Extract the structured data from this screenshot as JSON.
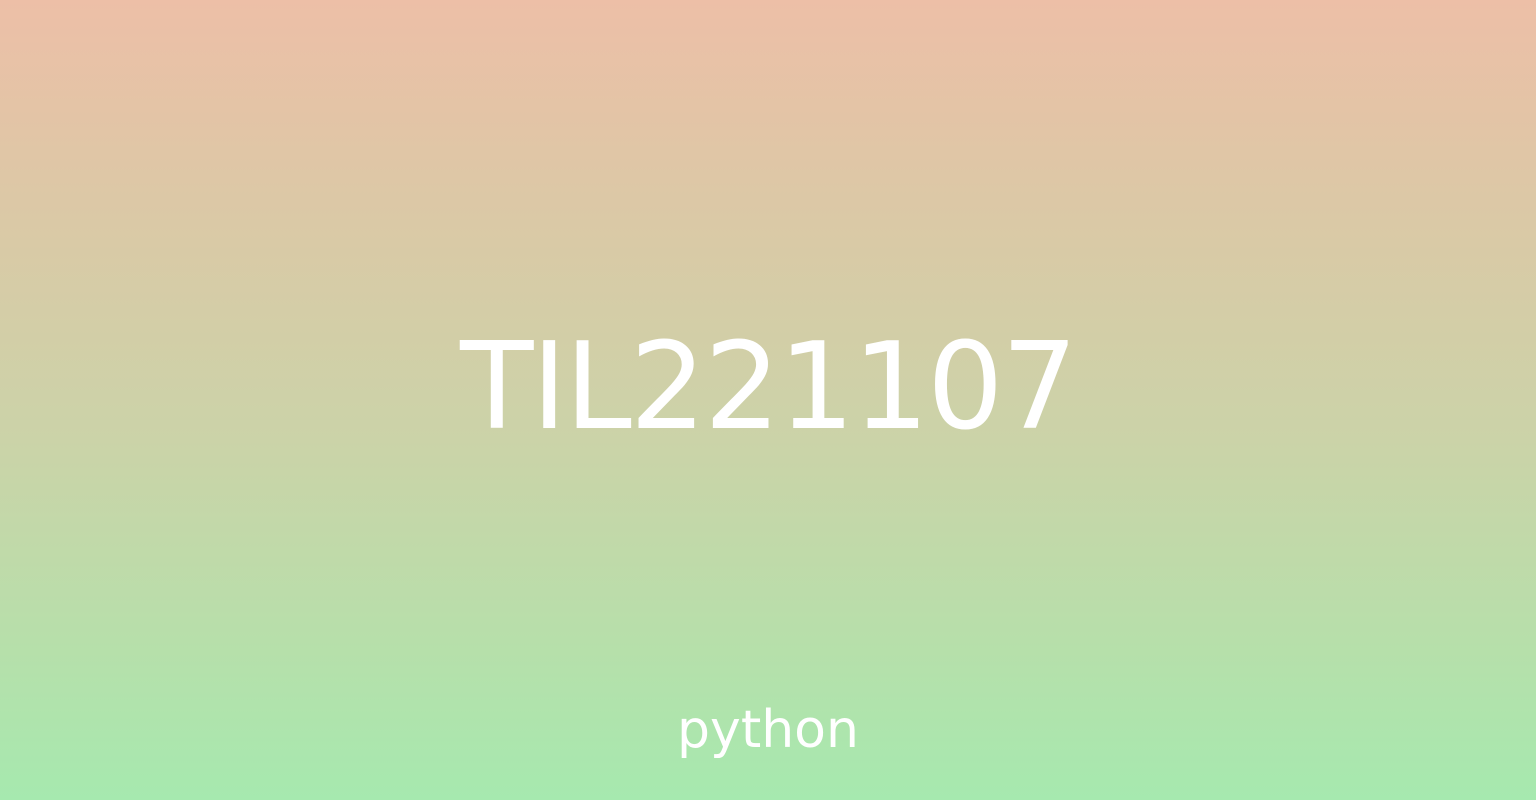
{
  "title": "TIL221107",
  "tag": "python",
  "colors": {
    "gradient_top": "#EDBFA7",
    "gradient_bottom": "#A6E9AF",
    "text": "#FFFFFF"
  }
}
